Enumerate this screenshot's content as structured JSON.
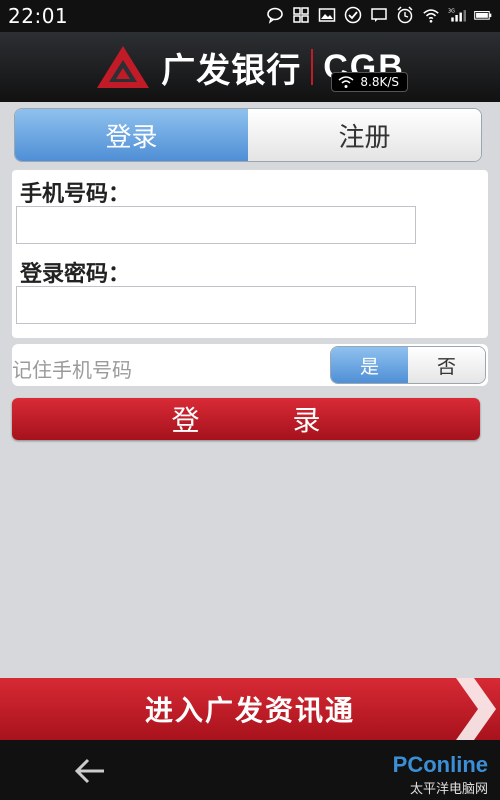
{
  "status_bar": {
    "time": "22:01",
    "icons": [
      "chat-bubble-icon",
      "grid-icon",
      "image-icon",
      "check-circle-icon",
      "message-icon",
      "alarm-icon",
      "wifi-icon",
      "signal-3g-icon",
      "battery-icon"
    ]
  },
  "header": {
    "bank_name": "广发银行",
    "brand": "CGB",
    "speed": "8.8K/S"
  },
  "tabs": [
    {
      "label": "登录",
      "active": true
    },
    {
      "label": "注册",
      "active": false
    }
  ],
  "form": {
    "phone_label": "手机号码：",
    "phone_value": "",
    "password_label": "登录密码：",
    "password_value": ""
  },
  "remember": {
    "label": "记住手机号码",
    "yes": "是",
    "no": "否",
    "selected": "是"
  },
  "login_button": "登 录",
  "banner": {
    "label": "进入广发资讯通"
  },
  "watermark": {
    "brand": "PConline",
    "sub": "太平洋电脑网"
  },
  "colors": {
    "accent_red": "#c21b28",
    "accent_blue": "#4f8fd6"
  }
}
